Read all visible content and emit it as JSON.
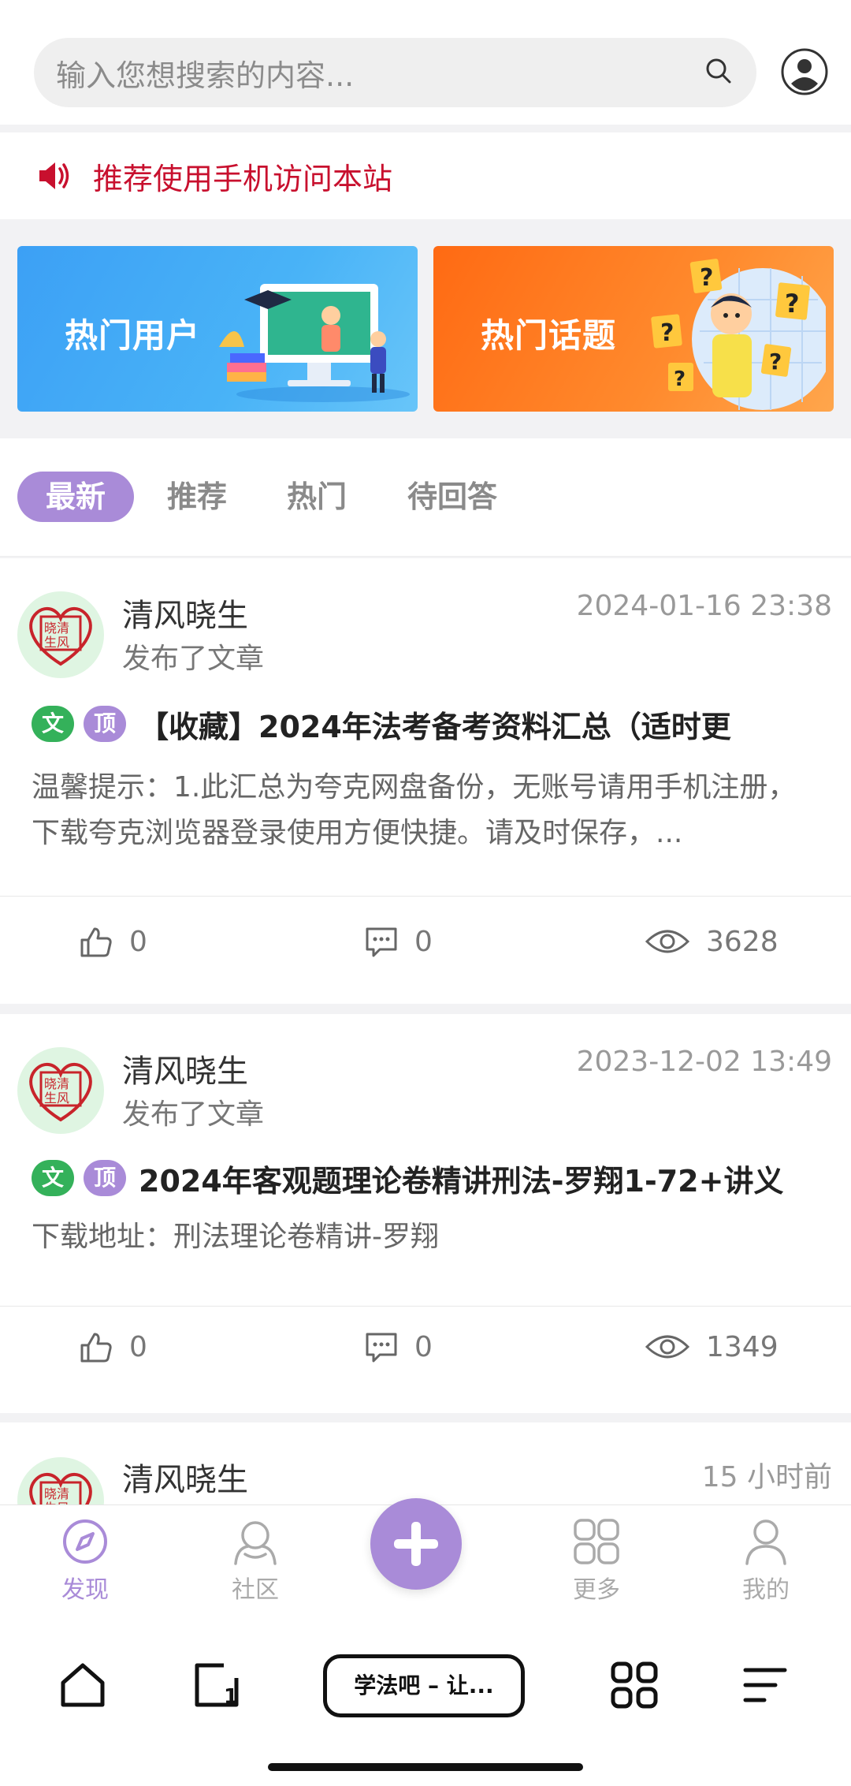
{
  "search": {
    "placeholder": "输入您想搜索的内容..."
  },
  "notice": {
    "text": "推荐使用手机访问本站"
  },
  "banners": [
    {
      "label": "热门用户"
    },
    {
      "label": "热门话题"
    }
  ],
  "tabs": [
    {
      "label": "最新",
      "active": true
    },
    {
      "label": "推荐"
    },
    {
      "label": "热门"
    },
    {
      "label": "待回答"
    }
  ],
  "posts": [
    {
      "user": "清风晓生",
      "action": "发布了文章",
      "time": "2024-01-16 23:38",
      "badges": [
        "文",
        "顶"
      ],
      "title": "【收藏】2024年法考备考资料汇总（适时更",
      "excerpt": "温馨提示：1.此汇总为夸克网盘备份，无账号请用手机注册，下载夸克浏览器登录使用方便快捷。请及时保存，...",
      "likes": "0",
      "comments": "0",
      "views": "3628"
    },
    {
      "user": "清风晓生",
      "action": "发布了文章",
      "time": "2023-12-02 13:49",
      "badges": [
        "文",
        "顶"
      ],
      "title": "2024年客观题理论卷精讲刑法-罗翔1-72+讲义",
      "excerpt": "下载地址：刑法理论卷精讲-罗翔",
      "likes": "0",
      "comments": "0",
      "views": "1349"
    },
    {
      "user": "清风晓生",
      "time": "15 小时前"
    }
  ],
  "appnav": [
    {
      "label": "发现",
      "icon": "compass-icon",
      "active": true
    },
    {
      "label": "社区",
      "icon": "community-icon"
    },
    {
      "label": "",
      "icon": "plus-icon"
    },
    {
      "label": "更多",
      "icon": "grid-icon"
    },
    {
      "label": "我的",
      "icon": "user-icon"
    }
  ],
  "browser": {
    "tab_title": "学法吧 – 让..."
  },
  "colors": {
    "accent": "#a98bd8",
    "notice_red": "#c8102e",
    "badge_green": "#34b15a"
  }
}
